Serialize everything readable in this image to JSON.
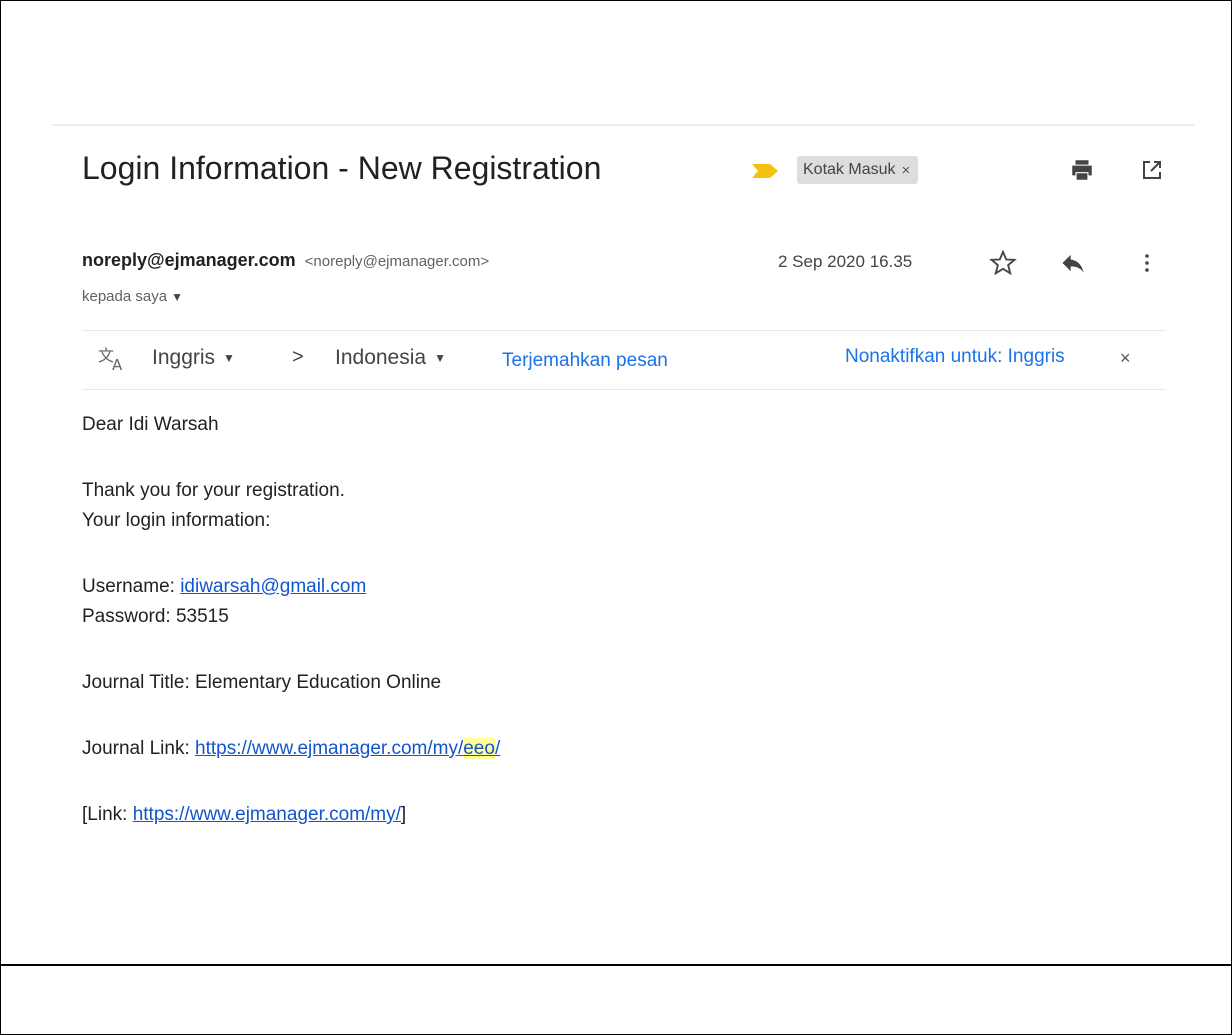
{
  "email": {
    "subject": "Login Information - New Registration",
    "label": "Kotak Masuk",
    "label_close": "×",
    "sender_name": "noreply@ejmanager.com",
    "sender_email": "<noreply@ejmanager.com>",
    "to": "kepada saya",
    "date": "2 Sep 2020 16.35"
  },
  "translate": {
    "from_lang": "Inggris",
    "arrow": ">",
    "to_lang": "Indonesia",
    "translate_label": "Terjemahkan pesan",
    "disable_label": "Nonaktifkan untuk: Inggris",
    "close": "×"
  },
  "body": {
    "greeting": "Dear Idi Warsah",
    "thanks": "Thank you for your registration.",
    "login_info": "Your login information:",
    "username_label": "Username: ",
    "username": "idiwarsah@gmail.com",
    "password_label": "Password: ",
    "password": "53515",
    "journal_title_label": "Journal Title: ",
    "journal_title": "Elementary Education Online",
    "journal_link_label": "Journal Link: ",
    "journal_link_prefix": "https://www.ejmanager.com/my/",
    "journal_link_highlight": "eeo",
    "journal_link_suffix": "/",
    "link_open": "[Link: ",
    "link_url": "https://www.ejmanager.com/my/",
    "link_close": "]"
  },
  "icons": {
    "importance": "importance-marker-icon",
    "print": "print-icon",
    "popout": "open-in-new-window-icon",
    "star": "star-icon",
    "reply": "reply-icon",
    "more": "more-vertical-icon",
    "translate": "translate-icon"
  },
  "colors": {
    "importance": "#f4c20d",
    "link": "#1155cc",
    "action_link": "#1a73e8",
    "highlight": "#ffff9c",
    "label_bg": "#dddddd"
  }
}
